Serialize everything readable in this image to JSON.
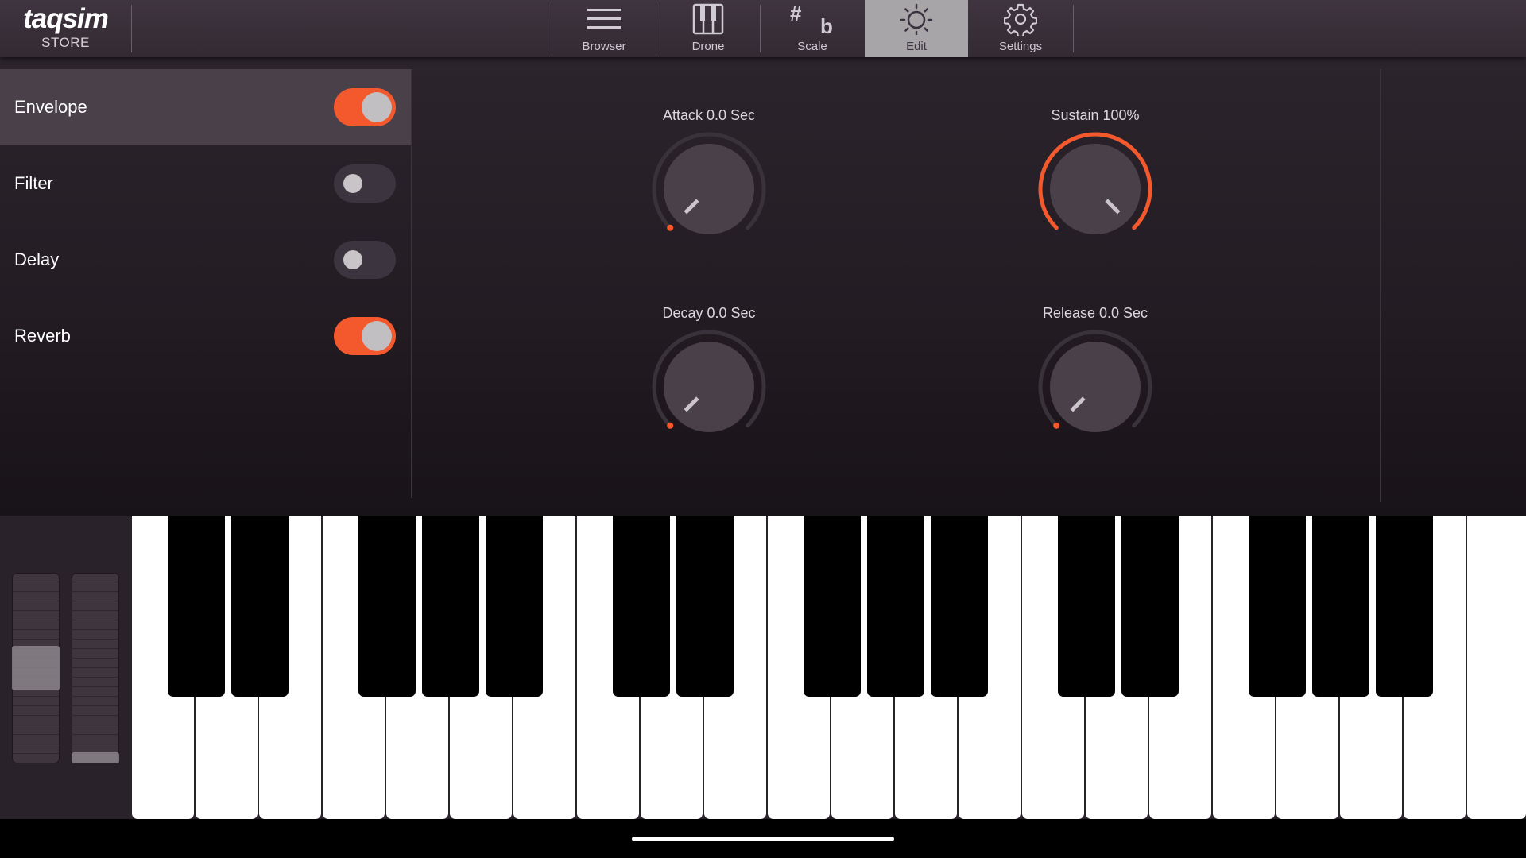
{
  "app": {
    "brand": "taqsim",
    "store_label": "STORE"
  },
  "nav": {
    "items": [
      {
        "id": "browser",
        "label": "Browser",
        "icon": "menu-icon",
        "active": false
      },
      {
        "id": "drone",
        "label": "Drone",
        "icon": "piano-icon",
        "active": false
      },
      {
        "id": "scale",
        "label": "Scale",
        "icon": "sharp-flat-icon",
        "active": false
      },
      {
        "id": "edit",
        "label": "Edit",
        "icon": "sun-icon",
        "active": true
      },
      {
        "id": "settings",
        "label": "Settings",
        "icon": "gear-icon",
        "active": false
      }
    ],
    "scale_glyphs": {
      "sharp": "#",
      "flat": "b"
    }
  },
  "effects": [
    {
      "label": "Envelope",
      "on": true,
      "selected": true
    },
    {
      "label": "Filter",
      "on": false,
      "selected": false
    },
    {
      "label": "Delay",
      "on": false,
      "selected": false
    },
    {
      "label": "Reverb",
      "on": true,
      "selected": false
    }
  ],
  "envelope": {
    "attack": {
      "label": "Attack 0.0 Sec",
      "value": 0
    },
    "sustain": {
      "label": "Sustain 100%",
      "value": 1
    },
    "decay": {
      "label": "Decay 0.0 Sec",
      "value": 0
    },
    "release": {
      "label": "Release 0.0 Sec",
      "value": 0
    }
  },
  "wheels": {
    "pitch": {
      "level": 0.5
    },
    "modulation": {
      "level": 0
    }
  },
  "colors": {
    "accent": "#f4592d",
    "knob_track": "#3a323a",
    "knob_body": "#4a404a",
    "pointer": "#c9c5c9"
  }
}
